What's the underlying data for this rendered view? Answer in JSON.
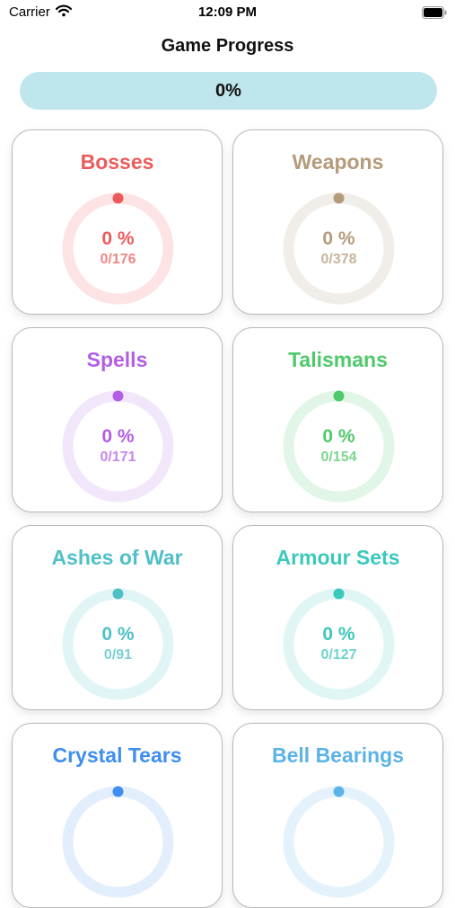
{
  "status_bar": {
    "carrier": "Carrier",
    "time": "12:09 PM"
  },
  "title": "Game Progress",
  "overall": {
    "label": "0%",
    "progress": 0,
    "track_color": "#bfe6ec",
    "fill_color": "#7fcbd8"
  },
  "categories": [
    {
      "name": "Bosses",
      "percent_label": "0 %",
      "count": "0/176",
      "progress": 0,
      "color": "#ec5b5b",
      "track_color": "#fde3e3"
    },
    {
      "name": "Weapons",
      "percent_label": "0 %",
      "count": "0/378",
      "progress": 0,
      "color": "#b49b7a",
      "track_color": "#f1eeea"
    },
    {
      "name": "Spells",
      "percent_label": "0 %",
      "count": "0/171",
      "progress": 0,
      "color": "#b25fe6",
      "track_color": "#f2e6fb"
    },
    {
      "name": "Talismans",
      "percent_label": "0 %",
      "count": "0/154",
      "progress": 0,
      "color": "#4fc96b",
      "track_color": "#e1f6e6"
    },
    {
      "name": "Ashes of War",
      "percent_label": "0 %",
      "count": "0/91",
      "progress": 0,
      "color": "#4fc0c8",
      "track_color": "#e1f5f6"
    },
    {
      "name": "Armour Sets",
      "percent_label": "0 %",
      "count": "0/127",
      "progress": 0,
      "color": "#3cc8bd",
      "track_color": "#e0f6f4"
    },
    {
      "name": "Crystal Tears",
      "percent_label": "",
      "count": "",
      "progress": 0,
      "color": "#3f8ef0",
      "track_color": "#e3eefd"
    },
    {
      "name": "Bell Bearings",
      "percent_label": "",
      "count": "",
      "progress": 0,
      "color": "#5cb3e6",
      "track_color": "#e4f2fb"
    }
  ]
}
